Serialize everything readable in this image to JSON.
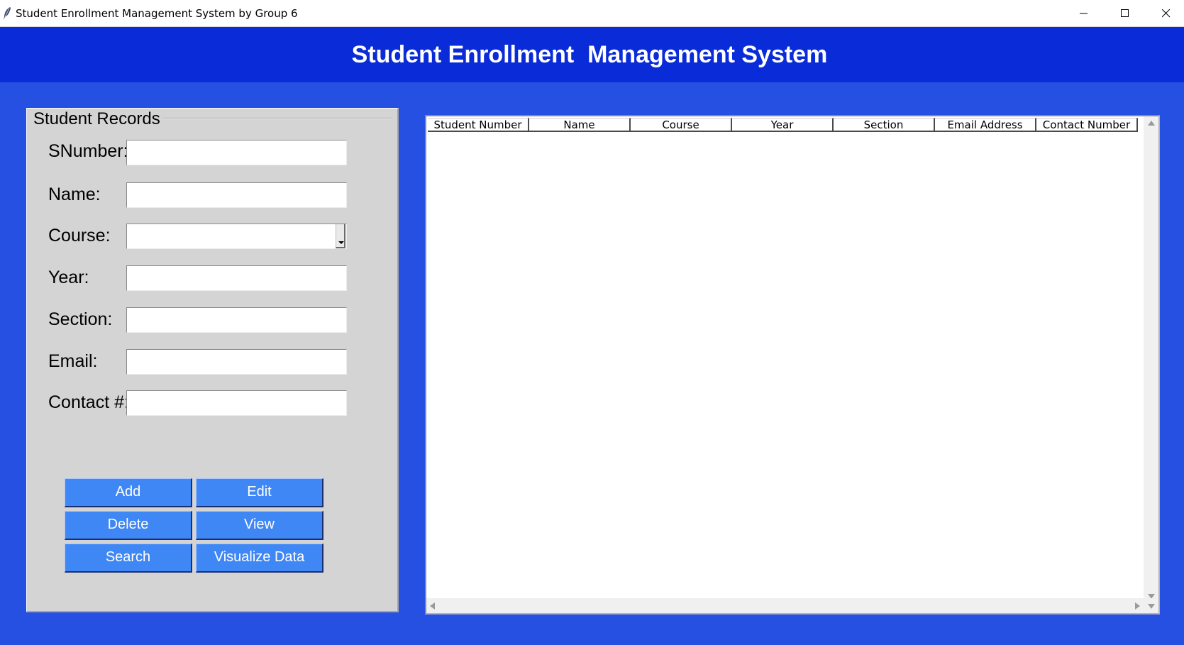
{
  "window": {
    "title": "Student Enrollment Management System by Group 6",
    "icon": "feather-icon",
    "controls": [
      "minimize-icon",
      "maximize-icon",
      "close-icon"
    ]
  },
  "header": {
    "title": "Student Enrollment  Management System"
  },
  "form": {
    "legend": "Student Records",
    "fields": [
      {
        "label": "SNumber:",
        "value": ""
      },
      {
        "label": "Name:",
        "value": ""
      },
      {
        "label": "Course:",
        "value": ""
      },
      {
        "label": "Year:",
        "value": ""
      },
      {
        "label": "Section:",
        "value": ""
      },
      {
        "label": "Email:",
        "value": ""
      },
      {
        "label": "Contact #:",
        "value": ""
      }
    ],
    "buttons": {
      "add": "Add",
      "edit": "Edit",
      "delete": "Delete",
      "view": "View",
      "search": "Search",
      "visualize": "Visualize Data"
    }
  },
  "table": {
    "columns": [
      "Student Number",
      "Name",
      "Course",
      "Year",
      "Section",
      "Email Address",
      "Contact Number"
    ],
    "rows": []
  },
  "colors": {
    "background": "#2550e2",
    "header": "#0a2bd8",
    "panel": "#d4d4d4",
    "button": "#3f87f5"
  }
}
